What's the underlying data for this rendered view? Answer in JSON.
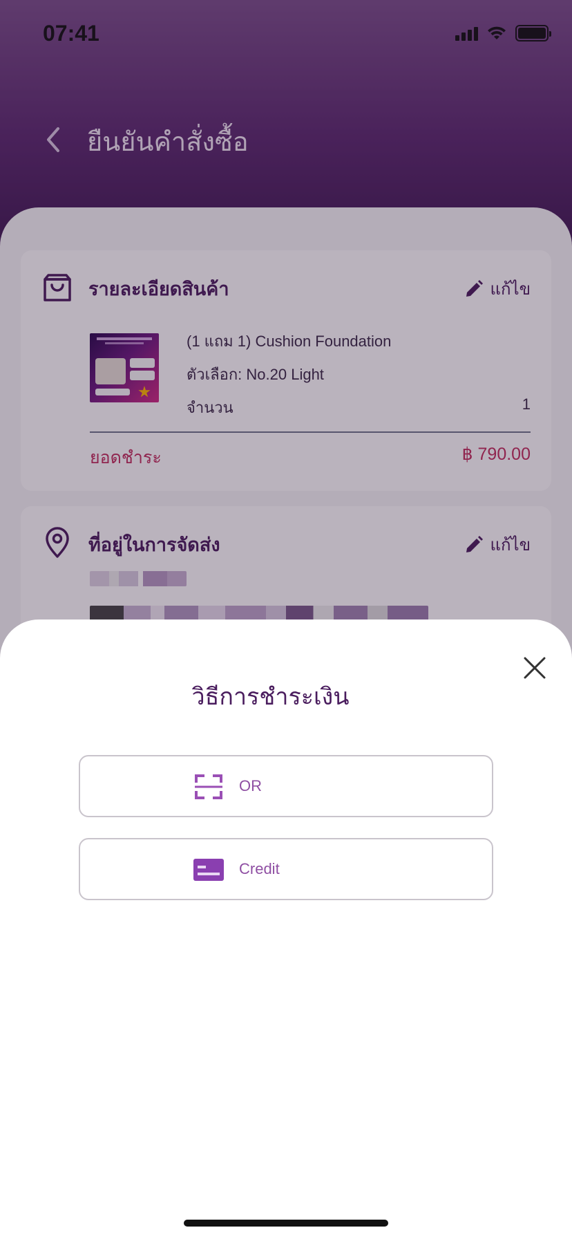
{
  "status_bar": {
    "time": "07:41"
  },
  "nav": {
    "title": "ยืนยันคำสั่งซื้อ"
  },
  "product_card": {
    "title": "รายละเอียดสินค้า",
    "edit_label": "แก้ไข",
    "product_name": "(1 แถม 1) Cushion Foundation",
    "option": "ตัวเลือก:  No.20 Light",
    "quantity_label": "จำนวน",
    "quantity": "1",
    "total_label": "ยอดชำระ",
    "total_value": "฿ 790.00"
  },
  "address_card": {
    "title": "ที่อยู่ในการจัดส่ง",
    "edit_label": "แก้ไข"
  },
  "payment_sheet": {
    "title": "วิธีการชำระเงิน",
    "options": [
      {
        "label": "OR",
        "icon": "qr-scan-icon"
      },
      {
        "label": "Credit",
        "icon": "credit-card-icon"
      }
    ]
  },
  "colors": {
    "header_top": "#7a4f8a",
    "header_bottom": "#3f1a52",
    "primary_text": "#4a1d5e",
    "accent_total": "#c22f5d",
    "option_label": "#8f4fa3"
  }
}
